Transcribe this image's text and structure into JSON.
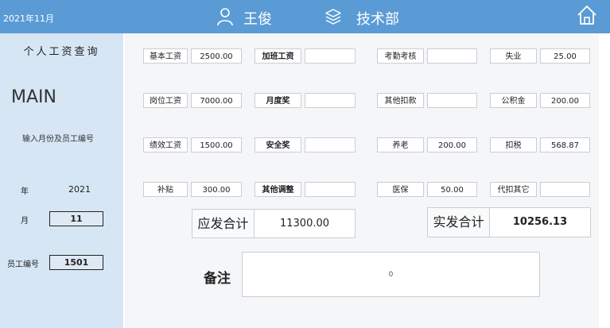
{
  "header": {
    "period": "2021年11月",
    "user_name": "王俊",
    "department": "技术部",
    "icons": {
      "user": "user-icon",
      "department": "layers-icon",
      "home": "home-icon"
    },
    "bg_color": "#5b9bd5"
  },
  "sidebar": {
    "title": "个人工资查询",
    "main_label": "MAIN",
    "hint": "输入月份及员工编号",
    "year_label": "年",
    "year_value": "2021",
    "month_label": "月",
    "month_value": "11",
    "emp_id_label": "员工编号",
    "emp_id_value": "1501",
    "bg_color": "#d6e6f4"
  },
  "earnings": {
    "base_label": "基本工资",
    "base_value": "2500.00",
    "post_label": "岗位工资",
    "post_value": "7000.00",
    "perf_label": "绩效工资",
    "perf_value": "1500.00",
    "subsidy_label": "补贴",
    "subsidy_value": "300.00"
  },
  "bonuses": {
    "overtime_label": "加班工资",
    "overtime_value": "",
    "monthly_label": "月度奖",
    "monthly_value": "",
    "safety_label": "安全奖",
    "safety_value": "",
    "other_label": "其他调整",
    "other_value": ""
  },
  "deductions": {
    "attendance_label": "考勤考核",
    "attendance_value": "",
    "other_deduct_label": "其他扣款",
    "other_deduct_value": "",
    "pension_label": "养老",
    "pension_value": "200.00",
    "medical_label": "医保",
    "medical_value": "50.00"
  },
  "insurance": {
    "unemployment_label": "失业",
    "unemployment_value": "25.00",
    "housing_label": "公积金",
    "housing_value": "200.00",
    "tax_label": "扣税",
    "tax_value": "568.87",
    "withhold_label": "代扣其它",
    "withhold_value": ""
  },
  "totals": {
    "gross_label": "应发合计",
    "gross_value": "11300.00",
    "net_label": "实发合计",
    "net_value": "10256.13"
  },
  "remarks": {
    "label": "备注",
    "value": "0"
  }
}
